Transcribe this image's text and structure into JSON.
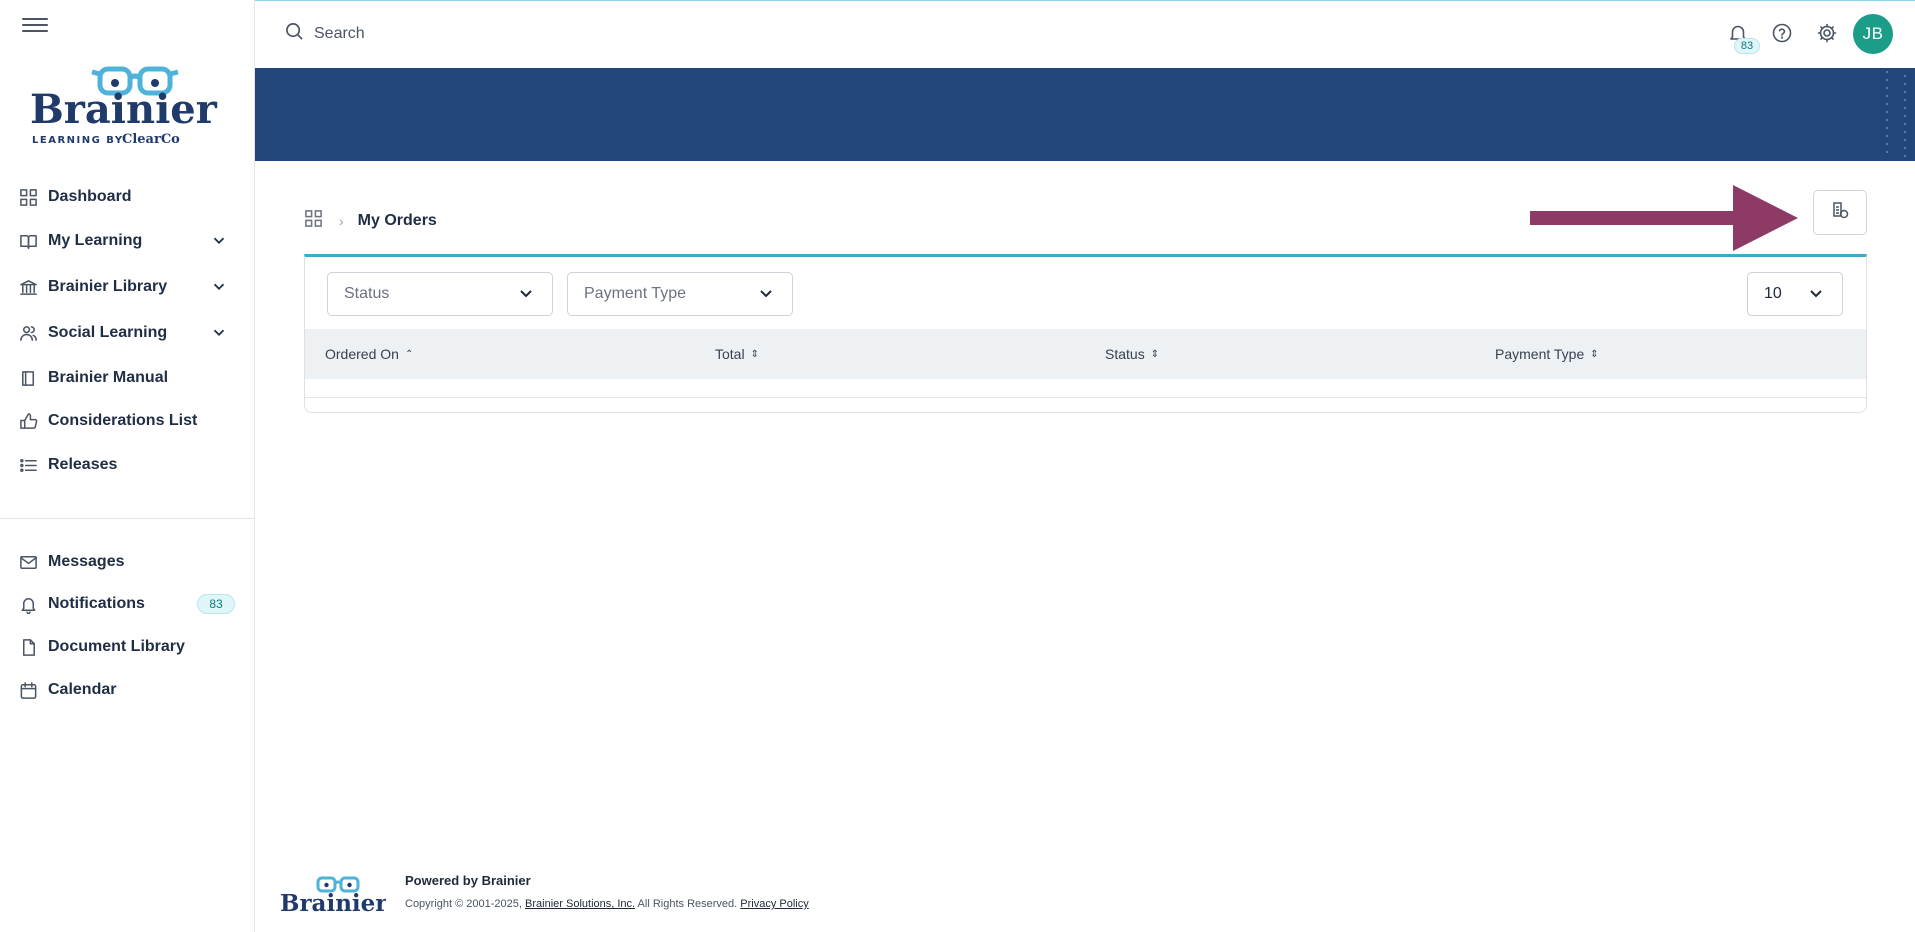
{
  "brand": {
    "name": "Brainier",
    "tagline": "LEARNING BY ClearCo"
  },
  "sidebar": {
    "items": [
      {
        "label": "Dashboard",
        "icon": "dashboard-grid-icon"
      },
      {
        "label": "My Learning",
        "icon": "book-open-icon",
        "expandable": true
      },
      {
        "label": "Brainier Library",
        "icon": "library-building-icon",
        "expandable": true
      },
      {
        "label": "Social Learning",
        "icon": "users-icon",
        "expandable": true
      },
      {
        "label": "Brainier Manual",
        "icon": "manual-book-icon"
      },
      {
        "label": "Considerations List",
        "icon": "thumbs-up-icon"
      },
      {
        "label": "Releases",
        "icon": "list-icon"
      }
    ],
    "secondary": [
      {
        "label": "Messages",
        "icon": "mail-icon"
      },
      {
        "label": "Notifications",
        "icon": "bell-icon",
        "badge": "83"
      },
      {
        "label": "Document Library",
        "icon": "document-icon"
      },
      {
        "label": "Calendar",
        "icon": "calendar-icon"
      }
    ]
  },
  "topbar": {
    "search_placeholder": "Search",
    "notification_count": "83",
    "avatar_initials": "JB"
  },
  "colors": {
    "banner": "#23467a",
    "accent": "#3fa9c9",
    "avatar": "#1b9d8a",
    "arrow": "#8e3a67"
  },
  "breadcrumb": {
    "current": "My Orders"
  },
  "filters": {
    "status_placeholder": "Status",
    "payment_type_placeholder": "Payment Type",
    "page_size": "10"
  },
  "table": {
    "columns": [
      {
        "label": "Ordered On",
        "sort": "asc"
      },
      {
        "label": "Total",
        "sort": "none"
      },
      {
        "label": "Status",
        "sort": "none"
      },
      {
        "label": "Payment Type",
        "sort": "none"
      }
    ],
    "rows": []
  },
  "footer": {
    "powered_by": "Powered by Brainier",
    "copyright_prefix": "Copyright © 2001-2025,",
    "company_link": "Brainier Solutions, Inc.",
    "rights": "All Rights Reserved.",
    "privacy_link": "Privacy Policy"
  }
}
